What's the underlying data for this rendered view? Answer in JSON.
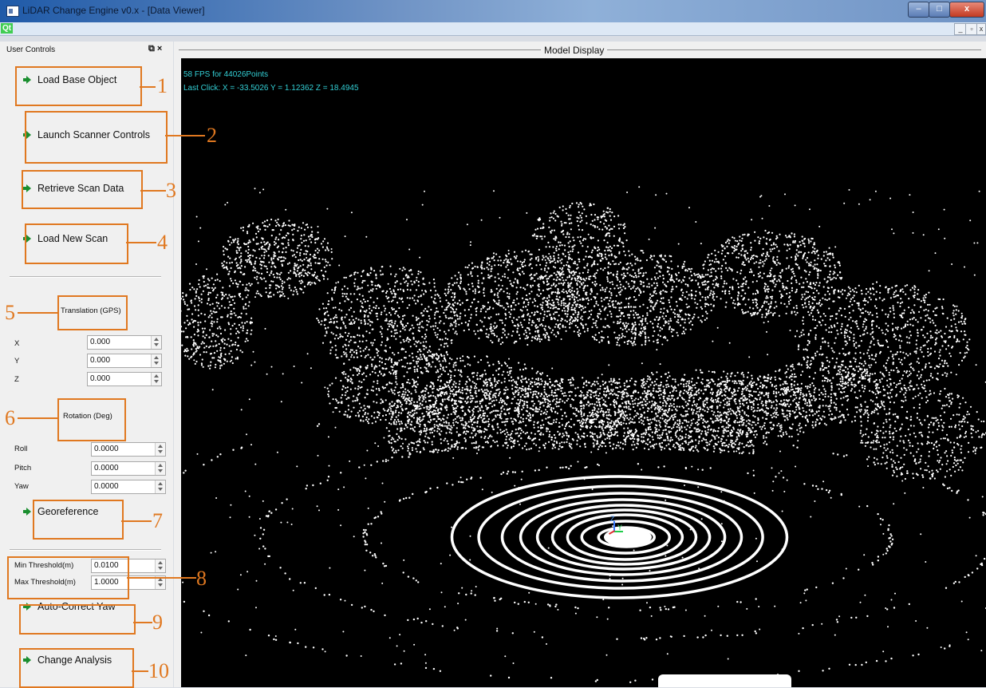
{
  "window": {
    "title": "LiDAR Change Engine v0.x - [Data Viewer]",
    "qt_label": "Qt",
    "controls": {
      "minimize": "–",
      "maximize": "□",
      "close": "x"
    },
    "mdi_controls": {
      "minimize": "_",
      "restore": "▫",
      "close": "x"
    }
  },
  "left_panel": {
    "title": "User Controls",
    "dock_controls": "⧉ ×",
    "buttons": {
      "load_base": "Load Base Object",
      "launch_scanner": "Launch Scanner Controls",
      "retrieve_scan": "Retrieve Scan Data",
      "load_new_scan": "Load New Scan",
      "georeference": "Georeference",
      "auto_correct_yaw": "Auto-Correct Yaw",
      "change_analysis": "Change Analysis"
    },
    "translation": {
      "label": "Translation (GPS)",
      "x_label": "X",
      "x": "0.000",
      "y_label": "Y",
      "y": "0.000",
      "z_label": "Z",
      "z": "0.000"
    },
    "rotation": {
      "label": "Rotation (Deg)",
      "roll_label": "Roll",
      "roll": "0.0000",
      "pitch_label": "Pitch",
      "pitch": "0.0000",
      "yaw_label": "Yaw",
      "yaw": "0.0000"
    },
    "threshold": {
      "min_label": "Min Threshold(m)",
      "min": "0.0100",
      "max_label": "Max Threshold(m)",
      "max": "1.0000"
    }
  },
  "display": {
    "title": "Model Display",
    "fps_text": "58 FPS for 44026Points",
    "last_click_text": "Last Click:  X = -33.5026 Y = 1.12362 Z = 18.4945",
    "axis_label_z": "Z",
    "axis_label_y": "Y"
  },
  "annotations": [
    "1",
    "2",
    "3",
    "4",
    "5",
    "6",
    "7",
    "8",
    "9",
    "10"
  ],
  "colors": {
    "annotation": "#e07820",
    "overlay_text": "#33d0d6",
    "arrow_icon": "#1a8e2f",
    "viewport_bg": "#000000",
    "points": "#ffffff"
  }
}
